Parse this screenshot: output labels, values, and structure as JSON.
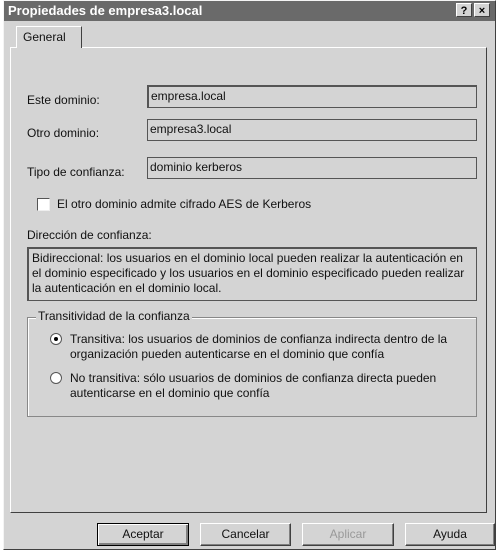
{
  "window": {
    "title": "Propiedades de empresa3.local",
    "help_button": "?",
    "close_button": "×"
  },
  "tabs": [
    {
      "label": "General"
    }
  ],
  "fields": {
    "este_dominio": {
      "label": "Este dominio:",
      "value": "empresa.local"
    },
    "otro_dominio": {
      "label": "Otro dominio:",
      "value": "empresa3.local"
    },
    "tipo_confianza": {
      "label": "Tipo de confianza:",
      "value": "dominio kerberos"
    }
  },
  "aes_checkbox": {
    "label": "El otro dominio admite cifrado AES de Kerberos",
    "checked": false
  },
  "direccion": {
    "label": "Dirección de confianza:",
    "text": "Bidireccional: los usuarios en el dominio local pueden realizar la autenticación en el dominio especificado y los usuarios en el dominio especificado pueden realizar la autenticación en el dominio local."
  },
  "transitividad": {
    "legend": "Transitividad de la confianza",
    "options": [
      {
        "label": "Transitiva: los usuarios de dominios de confianza indirecta dentro de la organización pueden autenticarse en el dominio que confía",
        "selected": true
      },
      {
        "label": "No transitiva: sólo usuarios de dominios de confianza directa pueden autenticarse en el dominio que confía",
        "selected": false
      }
    ]
  },
  "buttons": {
    "aceptar": "Aceptar",
    "cancelar": "Cancelar",
    "aplicar": "Aplicar",
    "ayuda": "Ayuda"
  }
}
